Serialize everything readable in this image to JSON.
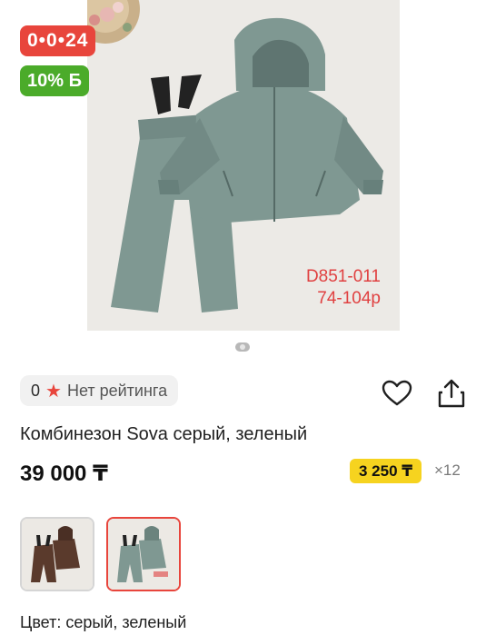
{
  "product": {
    "photo_caption_code": "D851-011",
    "photo_caption_sizes": "74-104р",
    "timer_badge": "0•0•24",
    "bonus_badge": "10% Б",
    "rating_value": "0",
    "rating_text": "Нет рейтинга",
    "title": "Комбинезон Sova серый, зеленый",
    "price": "39 000 ₸",
    "installment_price": "3 250 ₸",
    "installment_months": "×12",
    "color_label": "Цвет: серый, зеленый",
    "carousel_total": 1,
    "thumbnails": [
      {
        "name": "brown-variant",
        "color": "#5a3a2c"
      },
      {
        "name": "gray-green-variant",
        "color": "#7f9892"
      }
    ]
  },
  "colors": {
    "accent_red": "#e8453c",
    "bonus_green": "#4bab2a",
    "installment_yellow": "#f6d31f",
    "jacket": "#7f9892"
  }
}
